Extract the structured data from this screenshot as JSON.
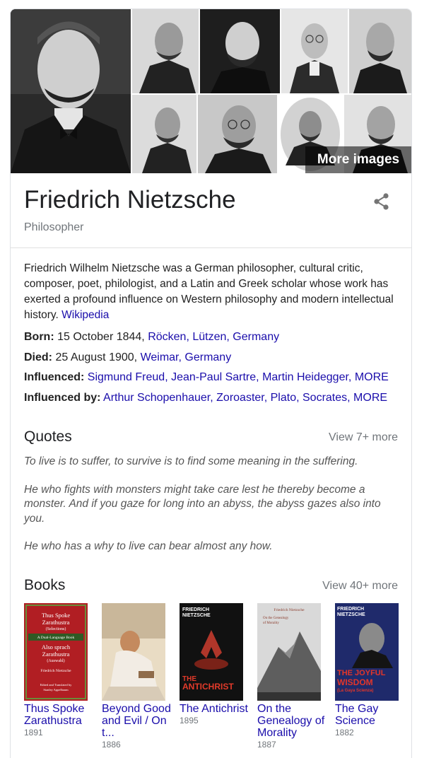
{
  "panel": {
    "more_images_label": "More images",
    "title": "Friedrich Nietzsche",
    "subtitle": "Philosopher",
    "description": "Friedrich Wilhelm Nietzsche was a German philosopher, cultural critic, composer, poet, philologist, and a Latin and Greek scholar whose work has exerted a profound influence on Western philosophy and modern intellectual history.",
    "description_source": "Wikipedia"
  },
  "facts": {
    "born": {
      "label": "Born:",
      "text": "15 October 1844,",
      "links": [
        "Röcken,",
        "Lützen,",
        "Germany"
      ]
    },
    "died": {
      "label": "Died:",
      "text": "25 August 1900,",
      "links": [
        "Weimar,",
        "Germany"
      ]
    },
    "influenced": {
      "label": "Influenced:",
      "links": [
        "Sigmund Freud,",
        "Jean-Paul Sartre,",
        "Martin Heidegger,",
        "MORE"
      ]
    },
    "influenced_by": {
      "label": "Influenced by:",
      "links": [
        "Arthur Schopenhauer,",
        "Zoroaster,",
        "Plato,",
        "Socrates,",
        "MORE"
      ]
    }
  },
  "quotes": {
    "title": "Quotes",
    "more": "View 7+ more",
    "items": [
      "To live is to suffer, to survive is to find some meaning in the suffering.",
      "He who fights with monsters might take care lest he thereby become a monster. And if you gaze for long into an abyss, the abyss gazes also into you.",
      "He who has a why to live can bear almost any how."
    ]
  },
  "books": {
    "title": "Books",
    "more": "View 40+ more",
    "items": [
      {
        "title": "Thus Spoke Zarathustra",
        "year": "1891"
      },
      {
        "title": "Beyond Good and Evil / On t...",
        "year": "1886"
      },
      {
        "title": "The Antichrist",
        "year": "1895"
      },
      {
        "title": "On the Genealogy of Morality",
        "year": "1887"
      },
      {
        "title": "The Gay Science",
        "year": "1882"
      }
    ],
    "cover_text": {
      "zarathustra": [
        "Thus Spoke",
        "Zarathustra",
        "(Selections)",
        "A Dual-Language Book",
        "Also sprach",
        "Zarathustra",
        "(Auswahl)",
        "Friedrich Nietzsche",
        "Edited and Translated by",
        "Stanley Appelbaum"
      ],
      "antichrist_author": [
        "FRIEDRICH",
        "NIETZSCHE"
      ],
      "antichrist_title": [
        "THE",
        "ANTICHRIST"
      ],
      "genealogy": [
        "Friedrich Nietzsche",
        "On the Genealogy",
        "of Morality"
      ],
      "gay_science_author": [
        "FRIEDRICH",
        "NIETZSCHE"
      ],
      "gay_science_title": [
        "THE JOYFUL",
        "WISDOM",
        "(La Gaya Scienza)"
      ]
    }
  },
  "colors": {
    "link": "#1a0dab",
    "muted": "#70757a",
    "zarathustra_cover": "#b11e23",
    "antichrist_cover": "#111111",
    "gay_science_cover": "#1f2a6b"
  },
  "icons": {
    "share": "share-icon"
  }
}
